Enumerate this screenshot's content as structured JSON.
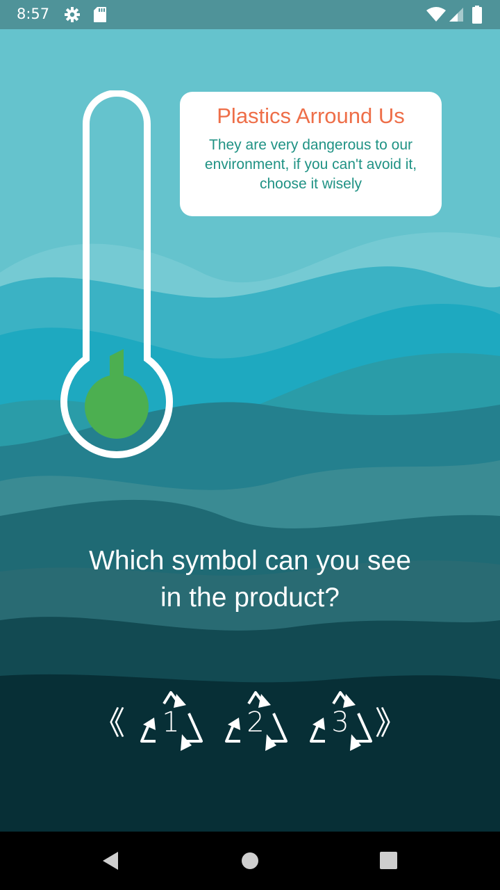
{
  "status_bar": {
    "time": "8:57",
    "icons": [
      "gear-icon",
      "sd-card-icon",
      "wifi-icon",
      "cell-signal-icon",
      "battery-icon"
    ]
  },
  "info_card": {
    "title": "Plastics Arround Us",
    "text": "They are very dangerous to our environment, if you can't avoid it, choose it wisely"
  },
  "thermometer": {
    "level": 0.12,
    "fill_color": "#4caf50"
  },
  "question": {
    "line1": "Which symbol can you see",
    "line2": "in the product?"
  },
  "symbol_picker": {
    "prev_glyph": "《",
    "next_glyph": "》",
    "symbols": [
      "1",
      "2",
      "3"
    ]
  },
  "nav_bar": {
    "buttons": [
      "back-icon",
      "home-icon",
      "recents-icon"
    ]
  },
  "colors": {
    "status_bar": "#4f9399",
    "sky": "#65c3cd",
    "deep_sea": "#03292f",
    "card_title": "#ee6e48",
    "card_text": "#1f9284"
  }
}
